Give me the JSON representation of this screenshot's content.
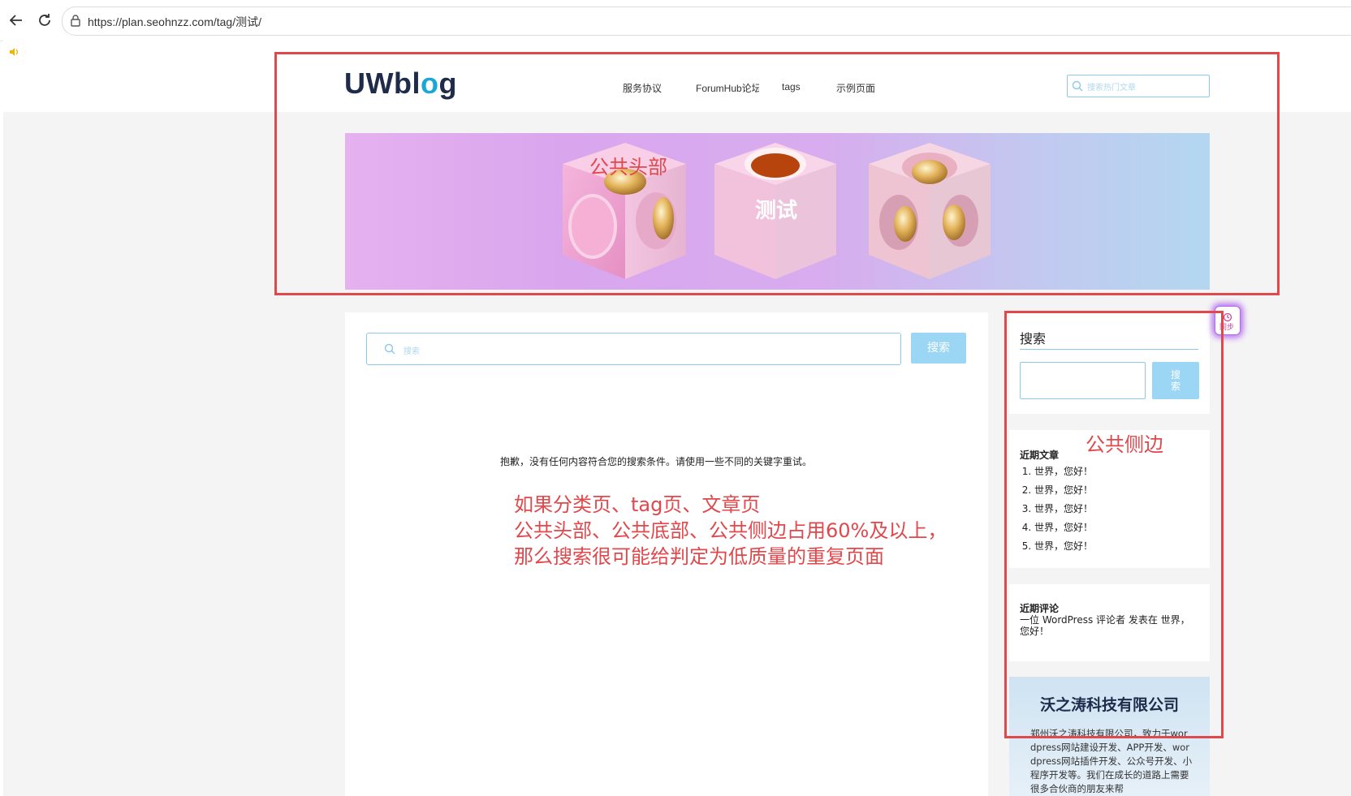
{
  "browser": {
    "url": "https://plan.seohnzz.com/tag/测试/"
  },
  "site": {
    "logo_main": "UWbl",
    "logo_o": "o",
    "logo_end": "g",
    "nav": [
      "服务协议",
      "ForumHub论坛",
      "tags",
      "示例页面"
    ],
    "top_search_placeholder": "搜索热门文章"
  },
  "banner": {
    "title": "测试"
  },
  "main": {
    "search_placeholder": "搜索",
    "search_button": "搜索",
    "no_results": "抱歉，没有任何内容符合您的搜索条件。请使用一些不同的关键字重试。"
  },
  "sidebar": {
    "search_title": "搜索",
    "search_button": "搜索",
    "recent_posts_title": "近期文章",
    "recent_posts": [
      "世界，您好！",
      "世界，您好！",
      "世界，您好！",
      "世界，您好！",
      "世界，您好！"
    ],
    "recent_comments_title": "近期评论",
    "recent_comment": "一位 WordPress 评论者 发表在 世界，您好！",
    "company_title": "沃之涛科技有限公司",
    "company_text": "郑州沃之涛科技有限公司，致力于wordpress网站建设开发、APP开发、wordpress网站插件开发、公众号开发、小程序开发等。我们在成长的道路上需要很多合伙商的朋友来帮"
  },
  "floating": {
    "sync_label": "同步"
  },
  "annotations": {
    "header_label": "公共头部",
    "sidebar_label": "公共侧边",
    "note_line1": "如果分类页、tag页、文章页",
    "note_line2": "公共头部、公共底部、公共侧边占用60%及以上，",
    "note_line3": "那么搜索很可能给判定为低质量的重复页面"
  },
  "colors": {
    "annotation_red": "#e0484c",
    "accent_blue": "#9bd6f4",
    "logo_dark": "#1e2c4a",
    "logo_o": "#1aa6d9"
  }
}
